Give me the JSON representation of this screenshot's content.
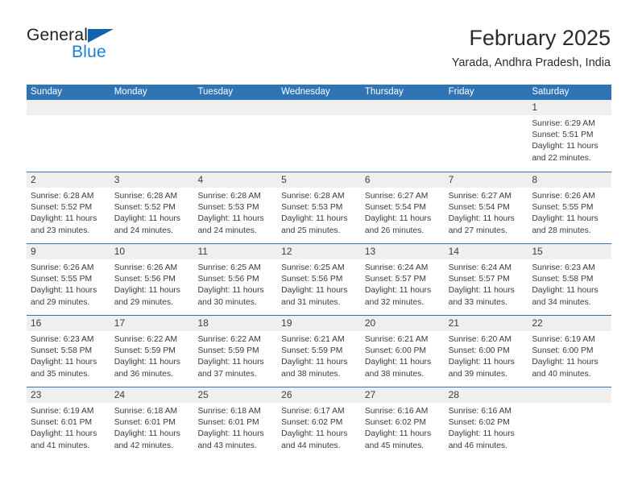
{
  "logo": {
    "word_one": "General",
    "word_two": "Blue",
    "triangle_icon": "triangle-icon",
    "accent_dark": "#1263ad",
    "accent_light": "#1a7fd4"
  },
  "header": {
    "title": "February 2025",
    "subtitle": "Yarada, Andhra Pradesh, India"
  },
  "colors": {
    "header_blue": "#2f74b5",
    "band_gray": "#efefef",
    "text": "#3a3a3a"
  },
  "weekdays": [
    "Sunday",
    "Monday",
    "Tuesday",
    "Wednesday",
    "Thursday",
    "Friday",
    "Saturday"
  ],
  "weeks": [
    [
      {
        "day": "",
        "lines": []
      },
      {
        "day": "",
        "lines": []
      },
      {
        "day": "",
        "lines": []
      },
      {
        "day": "",
        "lines": []
      },
      {
        "day": "",
        "lines": []
      },
      {
        "day": "",
        "lines": []
      },
      {
        "day": "1",
        "lines": [
          "Sunrise: 6:29 AM",
          "Sunset: 5:51 PM",
          "Daylight: 11 hours",
          "and 22 minutes."
        ]
      }
    ],
    [
      {
        "day": "2",
        "lines": [
          "Sunrise: 6:28 AM",
          "Sunset: 5:52 PM",
          "Daylight: 11 hours",
          "and 23 minutes."
        ]
      },
      {
        "day": "3",
        "lines": [
          "Sunrise: 6:28 AM",
          "Sunset: 5:52 PM",
          "Daylight: 11 hours",
          "and 24 minutes."
        ]
      },
      {
        "day": "4",
        "lines": [
          "Sunrise: 6:28 AM",
          "Sunset: 5:53 PM",
          "Daylight: 11 hours",
          "and 24 minutes."
        ]
      },
      {
        "day": "5",
        "lines": [
          "Sunrise: 6:28 AM",
          "Sunset: 5:53 PM",
          "Daylight: 11 hours",
          "and 25 minutes."
        ]
      },
      {
        "day": "6",
        "lines": [
          "Sunrise: 6:27 AM",
          "Sunset: 5:54 PM",
          "Daylight: 11 hours",
          "and 26 minutes."
        ]
      },
      {
        "day": "7",
        "lines": [
          "Sunrise: 6:27 AM",
          "Sunset: 5:54 PM",
          "Daylight: 11 hours",
          "and 27 minutes."
        ]
      },
      {
        "day": "8",
        "lines": [
          "Sunrise: 6:26 AM",
          "Sunset: 5:55 PM",
          "Daylight: 11 hours",
          "and 28 minutes."
        ]
      }
    ],
    [
      {
        "day": "9",
        "lines": [
          "Sunrise: 6:26 AM",
          "Sunset: 5:55 PM",
          "Daylight: 11 hours",
          "and 29 minutes."
        ]
      },
      {
        "day": "10",
        "lines": [
          "Sunrise: 6:26 AM",
          "Sunset: 5:56 PM",
          "Daylight: 11 hours",
          "and 29 minutes."
        ]
      },
      {
        "day": "11",
        "lines": [
          "Sunrise: 6:25 AM",
          "Sunset: 5:56 PM",
          "Daylight: 11 hours",
          "and 30 minutes."
        ]
      },
      {
        "day": "12",
        "lines": [
          "Sunrise: 6:25 AM",
          "Sunset: 5:56 PM",
          "Daylight: 11 hours",
          "and 31 minutes."
        ]
      },
      {
        "day": "13",
        "lines": [
          "Sunrise: 6:24 AM",
          "Sunset: 5:57 PM",
          "Daylight: 11 hours",
          "and 32 minutes."
        ]
      },
      {
        "day": "14",
        "lines": [
          "Sunrise: 6:24 AM",
          "Sunset: 5:57 PM",
          "Daylight: 11 hours",
          "and 33 minutes."
        ]
      },
      {
        "day": "15",
        "lines": [
          "Sunrise: 6:23 AM",
          "Sunset: 5:58 PM",
          "Daylight: 11 hours",
          "and 34 minutes."
        ]
      }
    ],
    [
      {
        "day": "16",
        "lines": [
          "Sunrise: 6:23 AM",
          "Sunset: 5:58 PM",
          "Daylight: 11 hours",
          "and 35 minutes."
        ]
      },
      {
        "day": "17",
        "lines": [
          "Sunrise: 6:22 AM",
          "Sunset: 5:59 PM",
          "Daylight: 11 hours",
          "and 36 minutes."
        ]
      },
      {
        "day": "18",
        "lines": [
          "Sunrise: 6:22 AM",
          "Sunset: 5:59 PM",
          "Daylight: 11 hours",
          "and 37 minutes."
        ]
      },
      {
        "day": "19",
        "lines": [
          "Sunrise: 6:21 AM",
          "Sunset: 5:59 PM",
          "Daylight: 11 hours",
          "and 38 minutes."
        ]
      },
      {
        "day": "20",
        "lines": [
          "Sunrise: 6:21 AM",
          "Sunset: 6:00 PM",
          "Daylight: 11 hours",
          "and 38 minutes."
        ]
      },
      {
        "day": "21",
        "lines": [
          "Sunrise: 6:20 AM",
          "Sunset: 6:00 PM",
          "Daylight: 11 hours",
          "and 39 minutes."
        ]
      },
      {
        "day": "22",
        "lines": [
          "Sunrise: 6:19 AM",
          "Sunset: 6:00 PM",
          "Daylight: 11 hours",
          "and 40 minutes."
        ]
      }
    ],
    [
      {
        "day": "23",
        "lines": [
          "Sunrise: 6:19 AM",
          "Sunset: 6:01 PM",
          "Daylight: 11 hours",
          "and 41 minutes."
        ]
      },
      {
        "day": "24",
        "lines": [
          "Sunrise: 6:18 AM",
          "Sunset: 6:01 PM",
          "Daylight: 11 hours",
          "and 42 minutes."
        ]
      },
      {
        "day": "25",
        "lines": [
          "Sunrise: 6:18 AM",
          "Sunset: 6:01 PM",
          "Daylight: 11 hours",
          "and 43 minutes."
        ]
      },
      {
        "day": "26",
        "lines": [
          "Sunrise: 6:17 AM",
          "Sunset: 6:02 PM",
          "Daylight: 11 hours",
          "and 44 minutes."
        ]
      },
      {
        "day": "27",
        "lines": [
          "Sunrise: 6:16 AM",
          "Sunset: 6:02 PM",
          "Daylight: 11 hours",
          "and 45 minutes."
        ]
      },
      {
        "day": "28",
        "lines": [
          "Sunrise: 6:16 AM",
          "Sunset: 6:02 PM",
          "Daylight: 11 hours",
          "and 46 minutes."
        ]
      },
      {
        "day": "",
        "lines": []
      }
    ]
  ]
}
